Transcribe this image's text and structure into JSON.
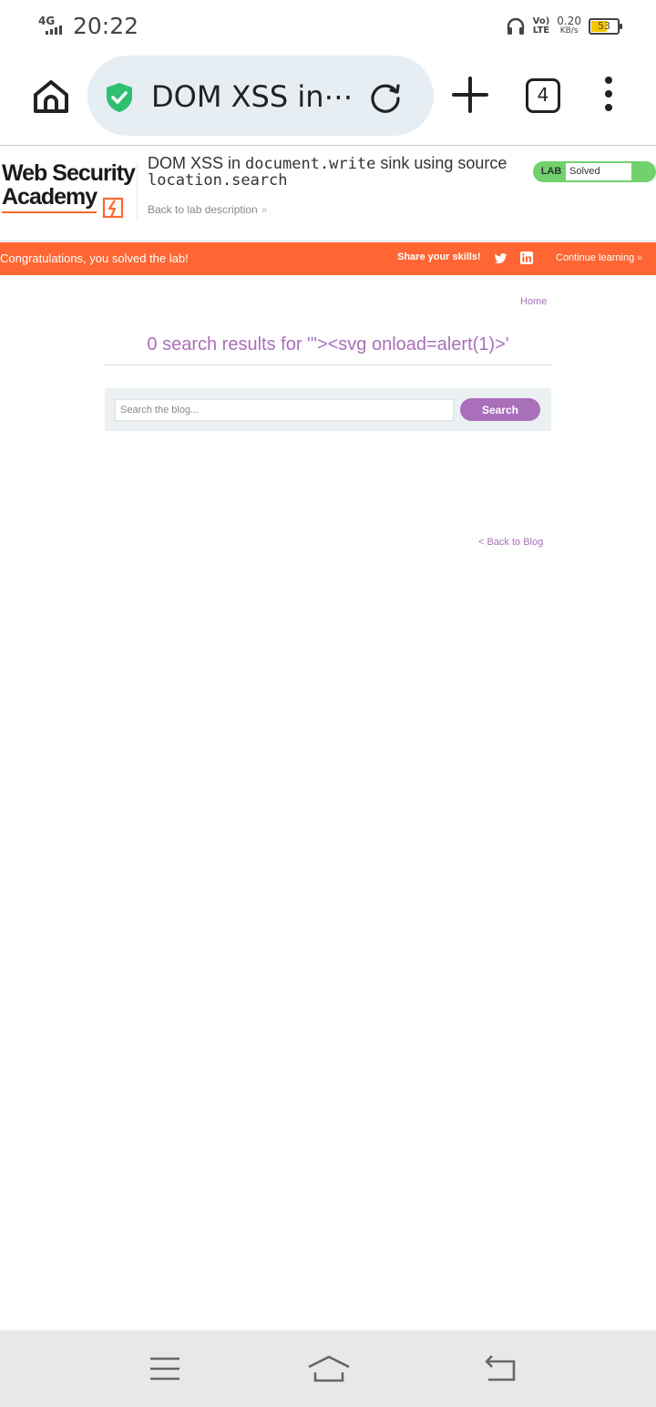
{
  "status_bar": {
    "network": "4G",
    "time": "20:22",
    "volte_top": "Vo)",
    "volte_bottom": "LTE",
    "speed_value": "0.20",
    "speed_unit": "KB/s",
    "battery_level": "53"
  },
  "browser": {
    "url_text": "DOM XSS in⋯",
    "tab_count": "4"
  },
  "lab": {
    "logo_line1": "Web Security",
    "logo_line2": "Academy",
    "title_prefix": "DOM XSS in ",
    "title_code1": "document.write",
    "title_middle": " sink using source ",
    "title_code2": "location.search",
    "back_to_description": "Back to lab description",
    "status_label": "LAB",
    "status_value": "Solved"
  },
  "banner": {
    "congrats": "Congratulations, you solved the lab!",
    "share": "Share your skills!",
    "continue": "Continue learning"
  },
  "content": {
    "home_link": "Home",
    "results_title": "0 search results for '\"><svg onload=alert(1)>'",
    "search_placeholder": "Search the blog...",
    "search_button": "Search",
    "back_to_blog": "< Back to Blog"
  },
  "colors": {
    "accent_orange": "#ff6633",
    "link_purple": "#a96fba",
    "solved_green": "#70d16d"
  }
}
